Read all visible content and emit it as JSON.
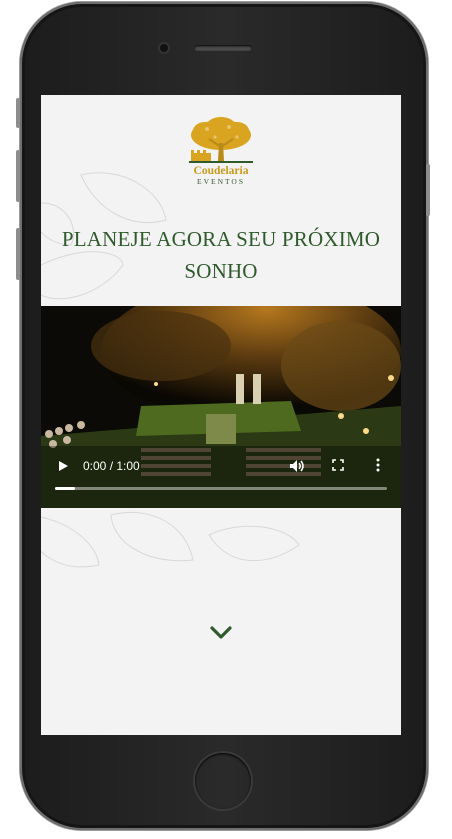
{
  "brand": {
    "name": "Coudelaria",
    "subtitle": "EVENTOS",
    "color_gold": "#c99a1c",
    "color_green": "#2f5a2b"
  },
  "hero": {
    "headline_line1": "PLANEJE AGORA SEU PRÓXIMO",
    "headline_line2": "SONHO"
  },
  "video": {
    "time_display": "0:00 / 1:00",
    "progress": 0.06,
    "icons": [
      "play-icon",
      "volume-icon",
      "fullscreen-icon",
      "more-options-icon"
    ]
  },
  "scroll": {
    "icon": "chevron-down-icon"
  }
}
